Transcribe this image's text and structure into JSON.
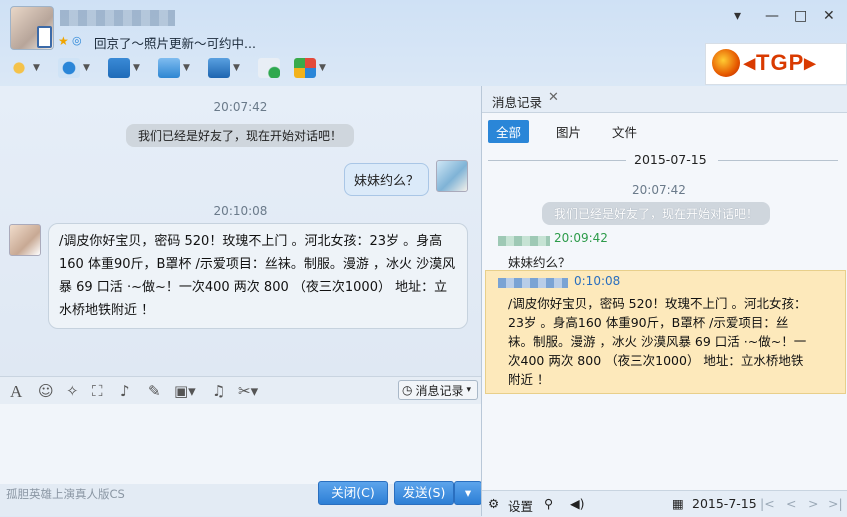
{
  "header": {
    "status_text": "回京了～照片更新～可约中...",
    "window_controls": [
      "▾",
      "—",
      "□",
      "✕"
    ],
    "ad_logo_text": "TGP",
    "icons": [
      "microphone-icon",
      "video-camera-icon",
      "screen-share-icon",
      "file-transfer-icon",
      "remote-desktop-icon",
      "add-chat-icon",
      "apps-grid-icon"
    ]
  },
  "chat": {
    "timestamp1": "20:07:42",
    "system_msg": "我们已经是好友了，现在开始对话吧！",
    "my_msg": "妹妹约么？",
    "timestamp2": "20:10:08",
    "other_msg": "/调皮你好宝贝，密码 520！玫瑰不上门 。河北女孩：23岁 。身高160 体重90斤，B罩杯 /示爱项目：丝袜。制服。漫游 ，冰火 沙漠风暴 69 口活 ·~做~！一次400 两次 800 （夜三次1000） 地址：立水桥地铁附近 ！"
  },
  "input_toolbar": {
    "history_button": "消息记录",
    "tool_icons": [
      "font-icon",
      "emoji-icon",
      "poke-icon",
      "screenshot-icon",
      "voice-icon",
      "edit-icon",
      "image-icon",
      "music-icon",
      "scissors-icon"
    ]
  },
  "bottom": {
    "ad_text": "孤胆英雄上演真人版CS",
    "close_button": "关闭(C)",
    "send_button": "发送(S)"
  },
  "history": {
    "tab_title": "消息记录",
    "filters": [
      "全部",
      "图片",
      "文件"
    ],
    "date": "2015-07-15",
    "timestamp": "20:07:42",
    "system_msg": "我们已经是好友了，现在开始对话吧！",
    "msg1_time": "20:09:42",
    "msg1_text": "妹妹约么？",
    "msg2_time": "0:10:08",
    "msg2_text": "/调皮你好宝贝，密码 520！玫瑰不上门 。河北女孩：23岁 。身高160 体重90斤，B罩杯 /示爱项目：丝袜。制服。漫游 ，冰火 沙漠风暴 69 口活 ·~做~！一次400 两次 800 （夜三次1000） 地址：立水桥地铁附近 ！",
    "settings_label": "设置",
    "footer_date": "2015-7-15"
  }
}
